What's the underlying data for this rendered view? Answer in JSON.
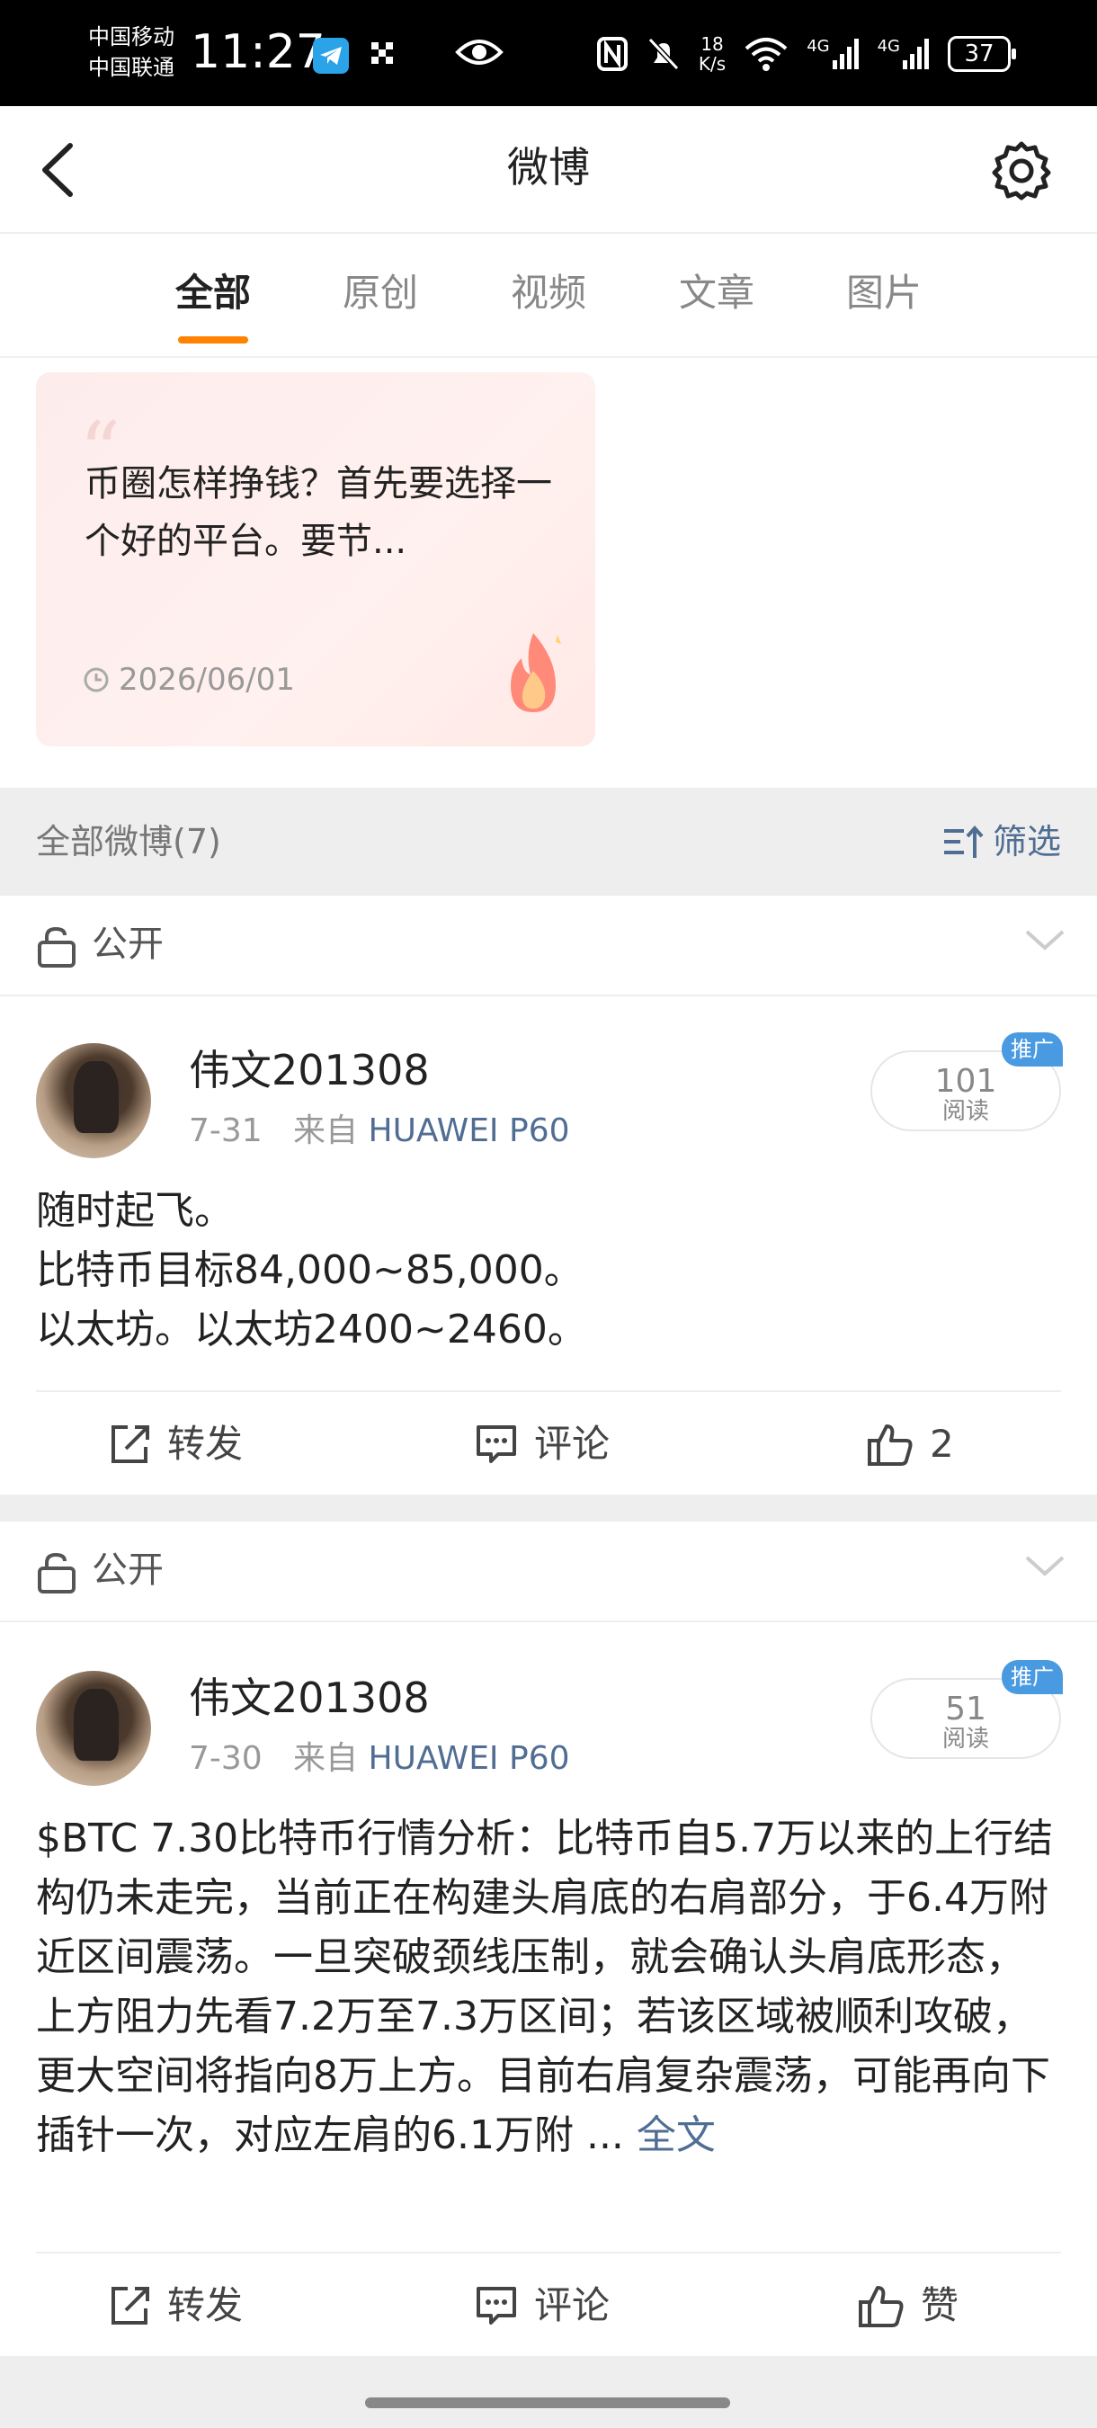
{
  "status_bar": {
    "carrier1": "中国移动",
    "carrier2": "中国联通",
    "time": "11:27",
    "speed_value": "18",
    "speed_unit": "K/s",
    "net1": "4G",
    "net2": "4G",
    "battery": "37"
  },
  "header": {
    "title": "微博"
  },
  "tabs": [
    {
      "label": "全部",
      "active": true
    },
    {
      "label": "原创"
    },
    {
      "label": "视频"
    },
    {
      "label": "文章"
    },
    {
      "label": "图片"
    }
  ],
  "pinned": {
    "text": "币圈怎样挣钱？首先要选择一个好的平台。要节...",
    "date": "2026/06/01"
  },
  "section": {
    "count_label": "全部微博(7)",
    "filter_label": "筛选"
  },
  "visibility_label": "公开",
  "posts": [
    {
      "username": "伟文201308",
      "date": "7-31",
      "from_label": "来自",
      "source": "HUAWEI P60",
      "read_count": "101",
      "read_label": "阅读",
      "promo": "推广",
      "lines": [
        "随时起飞。",
        "比特币目标84,000~85,000。",
        "以太坊。以太坊2400~2460。"
      ],
      "repost_label": "转发",
      "comment_label": "评论",
      "like_label": "2"
    },
    {
      "username": "伟文201308",
      "date": "7-30",
      "from_label": "来自",
      "source": "HUAWEI P60",
      "read_count": "51",
      "read_label": "阅读",
      "promo": "推广",
      "body": "$BTC 7.30比特币行情分析：比特币自5.7万以来的上行结构仍未走完，当前正在构建头肩底的右肩部分，于6.4万附近区间震荡。一旦突破颈线压制，就会确认头肩底形态，上方阻力先看7.2万至7.3万区间；若该区域被顺利攻破，更大空间将指向8万上方。目前右肩复杂震荡，可能再向下插针一次，对应左肩的6.1万附 ...",
      "more_label": "全文",
      "repost_label": "转发",
      "comment_label": "评论",
      "like_label": "赞"
    }
  ]
}
